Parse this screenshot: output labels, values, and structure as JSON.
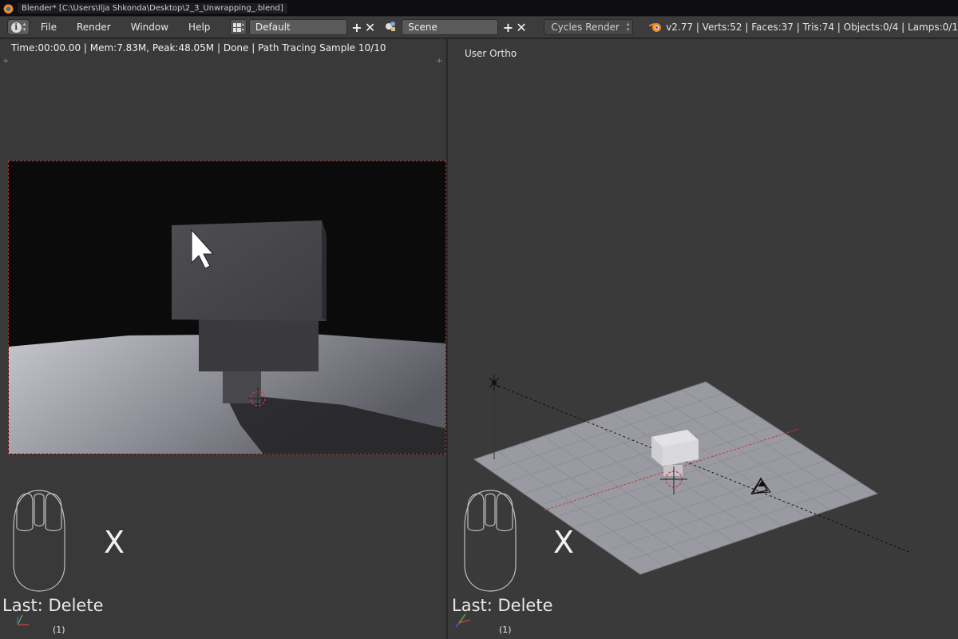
{
  "window": {
    "title": "Blender* [C:\\Users\\Ilja Shkonda\\Desktop\\2_3_Unwrapping_.blend]"
  },
  "header": {
    "menu": [
      "File",
      "Render",
      "Window",
      "Help"
    ],
    "layout_name": "Default",
    "scene_name": "Scene",
    "render_engine": "Cycles Render",
    "stats": "v2.77 | Verts:52 | Faces:37 | Tris:74 | Objects:0/4 | Lamps:0/1"
  },
  "left_view": {
    "render_status": "Time:00:00.00 | Mem:7.83M, Peak:48.05M | Done | Path Tracing Sample 10/10",
    "key_pressed": "X",
    "last_operator": "Last: Delete",
    "frame": "(1)"
  },
  "right_view": {
    "view_name": "User Ortho",
    "key_pressed": "X",
    "last_operator": "Last: Delete",
    "frame": "(1)"
  },
  "colors": {
    "header_bg": "#3c3c3c",
    "viewport_bg": "#393939",
    "x_axis": "#c04040",
    "y_axis": "#5aa040",
    "z_axis": "#4060c0",
    "logo_orange": "#f08a24"
  }
}
